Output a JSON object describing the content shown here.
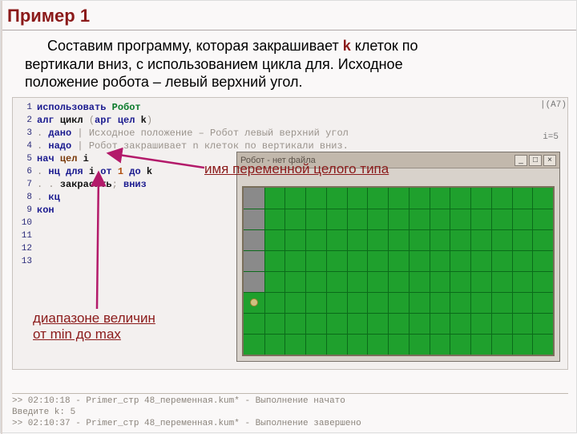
{
  "title": "Пример 1",
  "task": {
    "prefix_indent": "    ",
    "line1_a": "Составим программу, которая закрашивает ",
    "k": "k",
    "line1_b": " клеток по",
    "line2": "вертикали вниз, с использованием цикла для. Исходное",
    "line3": "положение робота – левый верхний угол."
  },
  "editor": {
    "line_count": 13,
    "code": [
      {
        "tokens": [
          {
            "cls": "kw-blue",
            "t": "использовать "
          },
          {
            "cls": "kw-green",
            "t": "Робот"
          }
        ]
      },
      {
        "tokens": [
          {
            "cls": "kw-blue",
            "t": "алг "
          },
          {
            "cls": "kw-black",
            "t": "цикл"
          },
          {
            "cls": "comment",
            "t": " ("
          },
          {
            "cls": "kw-blue",
            "t": "арг цел "
          },
          {
            "cls": "kw-black",
            "t": "k"
          },
          {
            "cls": "comment",
            "t": ")"
          }
        ]
      },
      {
        "tokens": [
          {
            "cls": "comment",
            "t": ". "
          },
          {
            "cls": "kw-blue",
            "t": "дано"
          },
          {
            "cls": "comment",
            "t": " | Исходное положение – Робот левый верхний угол"
          }
        ]
      },
      {
        "tokens": [
          {
            "cls": "comment",
            "t": ". "
          },
          {
            "cls": "kw-blue",
            "t": "надо"
          },
          {
            "cls": "comment",
            "t": " | Робот закрашивает n клеток по вертикали вниз."
          }
        ]
      },
      {
        "tokens": [
          {
            "cls": "kw-blue",
            "t": "нач "
          },
          {
            "cls": "kw-brown",
            "t": "цел "
          },
          {
            "cls": "kw-black",
            "t": "i"
          }
        ]
      },
      {
        "tokens": [
          {
            "cls": "comment",
            "t": ". "
          },
          {
            "cls": "kw-blue",
            "t": "нц для "
          },
          {
            "cls": "kw-black",
            "t": "i"
          },
          {
            "cls": "kw-blue",
            "t": " от "
          },
          {
            "cls": "orange",
            "t": "1"
          },
          {
            "cls": "kw-blue",
            "t": " до "
          },
          {
            "cls": "kw-black",
            "t": "k"
          }
        ]
      },
      {
        "tokens": [
          {
            "cls": "comment",
            "t": ". . "
          },
          {
            "cls": "kw-black",
            "t": "закрасить"
          },
          {
            "cls": "comment",
            "t": "; "
          },
          {
            "cls": "kw-blue",
            "t": "вниз"
          }
        ]
      },
      {
        "tokens": [
          {
            "cls": "comment",
            "t": ". "
          },
          {
            "cls": "kw-blue",
            "t": "кц"
          }
        ]
      },
      {
        "tokens": [
          {
            "cls": "kw-blue",
            "t": "кон"
          }
        ]
      },
      {
        "tokens": []
      },
      {
        "tokens": []
      },
      {
        "tokens": []
      },
      {
        "tokens": []
      }
    ],
    "right_tag": "|(A7)",
    "info_i": "i=5"
  },
  "robot_window": {
    "title": "Робот - нет файла",
    "min": "_",
    "max": "□",
    "close": "×",
    "cols": 15,
    "rows": 8,
    "painted": [
      [
        0,
        0
      ],
      [
        0,
        1
      ],
      [
        0,
        2
      ],
      [
        0,
        3
      ],
      [
        0,
        4
      ]
    ],
    "robot_pos": [
      0,
      5
    ]
  },
  "annotations": {
    "var_type": "имя переменной целого типа",
    "range1": "диапазоне величин",
    "range2": "от min до max"
  },
  "output": {
    "l1": ">> 02:10:18 - Primer_стр 48_переменная.kum* - Выполнение начато",
    "l2": "Введите k: 5",
    "l3": ">> 02:10:37 - Primer_стр 48_переменная.kum* - Выполнение завершено"
  }
}
